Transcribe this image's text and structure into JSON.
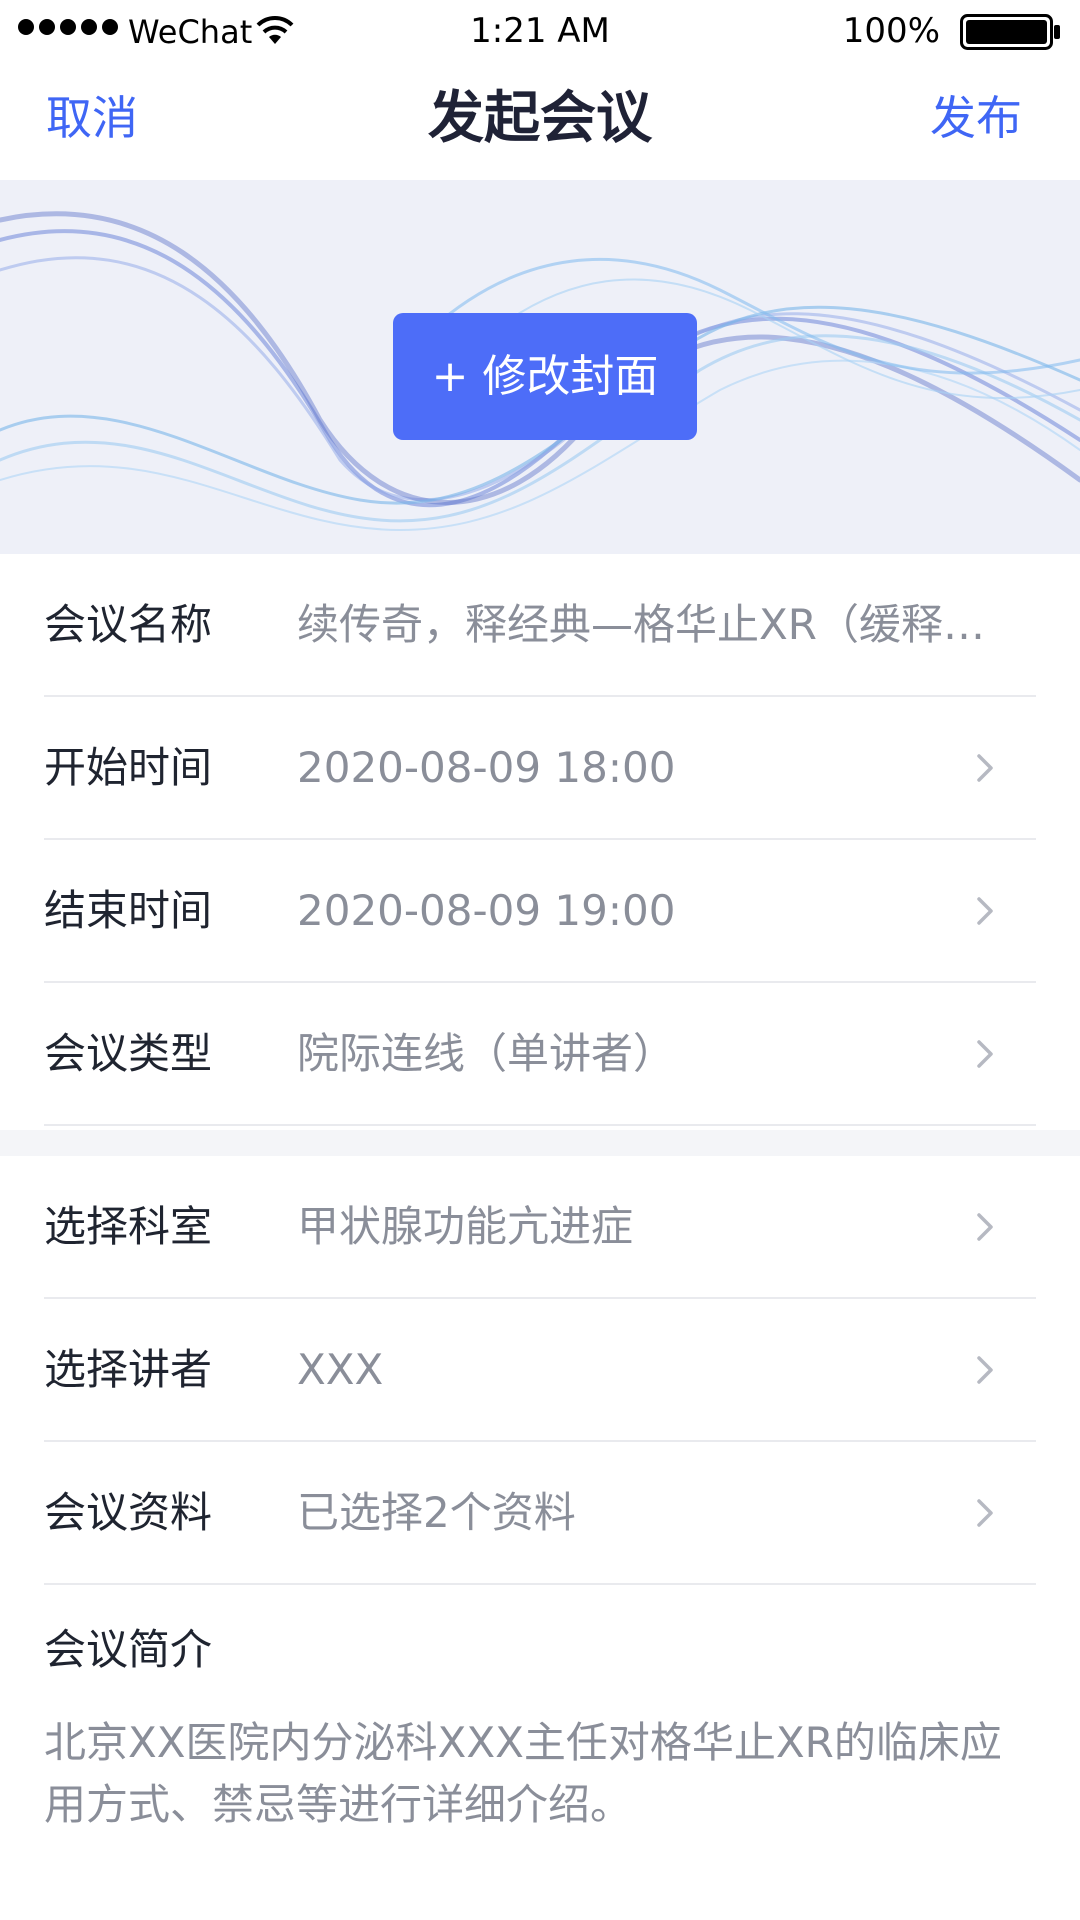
{
  "status_bar": {
    "carrier": "WeChat",
    "time": "1:21 AM",
    "battery": "100%"
  },
  "nav": {
    "cancel": "取消",
    "title": "发起会议",
    "publish": "发布"
  },
  "cover": {
    "change_button": "+ 修改封面"
  },
  "form": {
    "rows": [
      {
        "label": "会议名称",
        "value": "续传奇，释经典—格华止XR（缓释…"
      },
      {
        "label": "开始时间",
        "value": "2020-08-09 18:00"
      },
      {
        "label": "结束时间",
        "value": "2020-08-09 19:00"
      },
      {
        "label": "会议类型",
        "value": "院际连线（单讲者）"
      },
      {
        "label": "选择科室",
        "value": "甲状腺功能亢进症"
      },
      {
        "label": "选择讲者",
        "value": "XXX"
      },
      {
        "label": "会议资料",
        "value": "已选择2个资料"
      }
    ],
    "intro_label": "会议简介",
    "intro_text": "北京XX医院内分泌科XXX主任对格华止XR的临床应用方式、禁忌等进行详细介绍。"
  },
  "colors": {
    "accent": "#3f66f5",
    "button": "#4d6df8",
    "label": "#1f2430",
    "value": "#8a8e99"
  }
}
